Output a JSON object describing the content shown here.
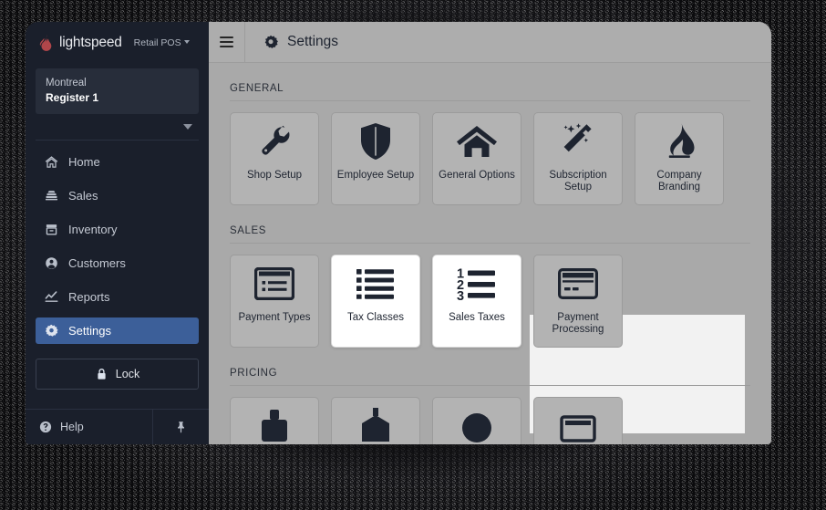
{
  "brand": {
    "logo_icon": "lightspeed-flame-icon",
    "name": "lightspeed",
    "product": "Retail POS",
    "accent_red": "#b0464a"
  },
  "sidebar": {
    "store": {
      "city": "Montreal",
      "register": "Register 1"
    },
    "expand_icon": "caret-down-icon",
    "items": [
      {
        "label": "Home",
        "icon": "home-icon",
        "active": false
      },
      {
        "label": "Sales",
        "icon": "cash-register-icon",
        "active": false
      },
      {
        "label": "Inventory",
        "icon": "inventory-box-icon",
        "active": false
      },
      {
        "label": "Customers",
        "icon": "user-circle-icon",
        "active": false
      },
      {
        "label": "Reports",
        "icon": "chart-line-icon",
        "active": false
      },
      {
        "label": "Settings",
        "icon": "gear-icon",
        "active": true
      }
    ],
    "lock": {
      "label": "Lock",
      "icon": "lock-icon"
    },
    "help": {
      "label": "Help",
      "icon": "question-circle-icon"
    },
    "pin": {
      "icon": "pin-icon"
    },
    "active_color": "#3c5f99",
    "background": "#1a1f2b"
  },
  "topbar": {
    "menu_icon": "hamburger-menu-icon",
    "title_icon": "gear-icon",
    "title": "Settings"
  },
  "content": {
    "sections": [
      {
        "label": "GENERAL",
        "tiles": [
          {
            "label": "Shop Setup",
            "icon": "wrench-icon",
            "highlighted": false
          },
          {
            "label": "Employee Setup",
            "icon": "shield-icon",
            "highlighted": false
          },
          {
            "label": "General Options",
            "icon": "home-icon",
            "highlighted": false
          },
          {
            "label": "Subscription Setup",
            "icon": "magic-wand-icon",
            "highlighted": false
          },
          {
            "label": "Company Branding",
            "icon": "flame-icon",
            "highlighted": false
          }
        ]
      },
      {
        "label": "SALES",
        "tiles": [
          {
            "label": "Payment Types",
            "icon": "window-list-icon",
            "highlighted": false
          },
          {
            "label": "Tax Classes",
            "icon": "bulleted-list-icon",
            "highlighted": true
          },
          {
            "label": "Sales Taxes",
            "icon": "numbered-list-icon",
            "highlighted": true
          },
          {
            "label": "Payment Processing",
            "icon": "credit-card-icon",
            "highlighted": false
          }
        ]
      },
      {
        "label": "PRICING",
        "tiles": [
          {
            "label": "",
            "icon": "tag-icon",
            "highlighted": false
          },
          {
            "label": "",
            "icon": "price-tag-icon",
            "highlighted": false
          },
          {
            "label": "",
            "icon": "discount-icon",
            "highlighted": false
          },
          {
            "label": "",
            "icon": "receipt-icon",
            "highlighted": false
          }
        ]
      }
    ],
    "background": "#a9a9a9",
    "highlight_background": "#f2f2f2"
  }
}
